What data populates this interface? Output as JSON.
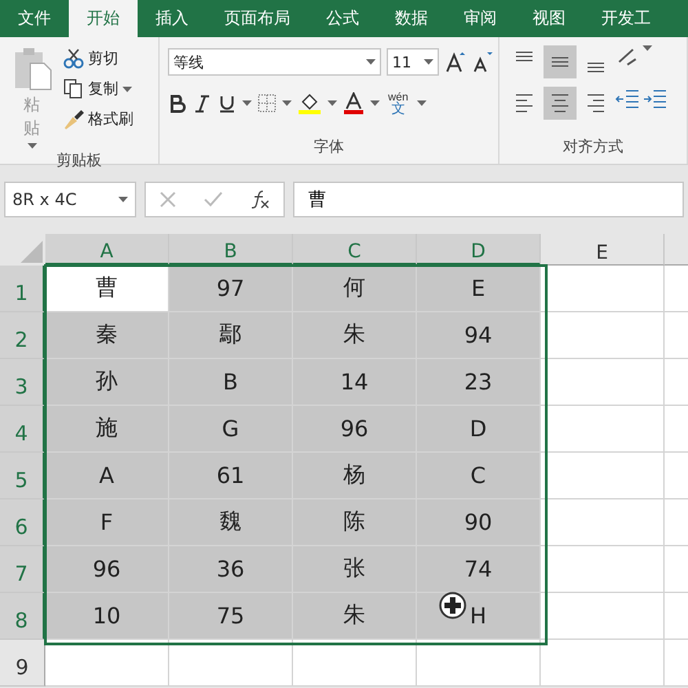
{
  "tabs": [
    {
      "label": "文件",
      "selected": false
    },
    {
      "label": "开始",
      "selected": true
    },
    {
      "label": "插入",
      "selected": false
    },
    {
      "label": "页面布局",
      "selected": false
    },
    {
      "label": "公式",
      "selected": false
    },
    {
      "label": "数据",
      "selected": false
    },
    {
      "label": "审阅",
      "selected": false
    },
    {
      "label": "视图",
      "selected": false
    },
    {
      "label": "开发工",
      "selected": false
    }
  ],
  "clipboard": {
    "paste": "粘贴",
    "items": [
      {
        "kind": "cut",
        "label": "剪切"
      },
      {
        "kind": "copy",
        "label": "复制"
      },
      {
        "kind": "painter",
        "label": "格式刷"
      }
    ],
    "group_label": "剪贴板"
  },
  "font": {
    "font_name": "等线",
    "font_size": "11",
    "phonetic_top": "wén",
    "phonetic_bottom": "文",
    "group_label": "字体"
  },
  "alignment": {
    "vertical": [
      {
        "kind": "top",
        "selected": false
      },
      {
        "kind": "middle",
        "selected": true
      },
      {
        "kind": "bottom",
        "selected": false
      }
    ],
    "horizontal": [
      {
        "kind": "left",
        "selected": false
      },
      {
        "kind": "center",
        "selected": true
      },
      {
        "kind": "right",
        "selected": false
      }
    ],
    "group_label": "对齐方式"
  },
  "name_box": "8R x 4C",
  "formula": "曹",
  "sheet": {
    "columns": [
      {
        "label": "A",
        "selected": true
      },
      {
        "label": "B",
        "selected": true
      },
      {
        "label": "C",
        "selected": true
      },
      {
        "label": "D",
        "selected": true
      },
      {
        "label": "E",
        "selected": false
      }
    ],
    "rows": [
      {
        "header": "1",
        "selected": true,
        "cells": [
          {
            "text": "曹",
            "selected": false
          },
          {
            "text": "97",
            "selected": true
          },
          {
            "text": "何",
            "selected": true
          },
          {
            "text": "E",
            "selected": true
          },
          {
            "text": "",
            "selected": false
          }
        ]
      },
      {
        "header": "2",
        "selected": true,
        "cells": [
          {
            "text": "秦",
            "selected": true
          },
          {
            "text": "鄢",
            "selected": true
          },
          {
            "text": "朱",
            "selected": true
          },
          {
            "text": "94",
            "selected": true
          },
          {
            "text": "",
            "selected": false
          }
        ]
      },
      {
        "header": "3",
        "selected": true,
        "cells": [
          {
            "text": "孙",
            "selected": true
          },
          {
            "text": "B",
            "selected": true
          },
          {
            "text": "14",
            "selected": true
          },
          {
            "text": "23",
            "selected": true
          },
          {
            "text": "",
            "selected": false
          }
        ]
      },
      {
        "header": "4",
        "selected": true,
        "cells": [
          {
            "text": "施",
            "selected": true
          },
          {
            "text": "G",
            "selected": true
          },
          {
            "text": "96",
            "selected": true
          },
          {
            "text": "D",
            "selected": true
          },
          {
            "text": "",
            "selected": false
          }
        ]
      },
      {
        "header": "5",
        "selected": true,
        "cells": [
          {
            "text": "A",
            "selected": true
          },
          {
            "text": "61",
            "selected": true
          },
          {
            "text": "杨",
            "selected": true
          },
          {
            "text": "C",
            "selected": true
          },
          {
            "text": "",
            "selected": false
          }
        ]
      },
      {
        "header": "6",
        "selected": true,
        "cells": [
          {
            "text": "F",
            "selected": true
          },
          {
            "text": "魏",
            "selected": true
          },
          {
            "text": "陈",
            "selected": true
          },
          {
            "text": "90",
            "selected": true
          },
          {
            "text": "",
            "selected": false
          }
        ]
      },
      {
        "header": "7",
        "selected": true,
        "cells": [
          {
            "text": "96",
            "selected": true
          },
          {
            "text": "36",
            "selected": true
          },
          {
            "text": "张",
            "selected": true
          },
          {
            "text": "74",
            "selected": true
          },
          {
            "text": "",
            "selected": false
          }
        ]
      },
      {
        "header": "8",
        "selected": true,
        "cells": [
          {
            "text": "10",
            "selected": true
          },
          {
            "text": "75",
            "selected": true
          },
          {
            "text": "朱",
            "selected": true
          },
          {
            "text": "H",
            "selected": true
          },
          {
            "text": "",
            "selected": false
          }
        ]
      },
      {
        "header": "9",
        "selected": false,
        "cells": [
          {
            "text": "",
            "selected": false
          },
          {
            "text": "",
            "selected": false
          },
          {
            "text": "",
            "selected": false
          },
          {
            "text": "",
            "selected": false
          },
          {
            "text": "",
            "selected": false
          }
        ]
      }
    ]
  }
}
